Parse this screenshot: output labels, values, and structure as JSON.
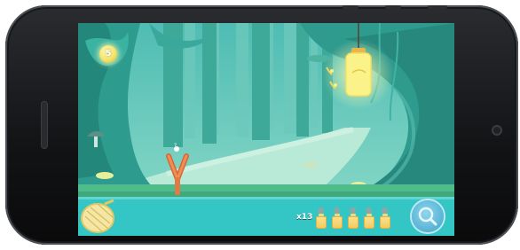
{
  "hud": {
    "coin_count": "5",
    "ammo_label": "x13",
    "jar_count": 5
  },
  "icons": {
    "coin": "coin-icon",
    "net": "butterfly-net-icon",
    "jar": "firefly-jar-icon",
    "magnifier": "magnifier-icon",
    "slingshot": "slingshot-icon"
  },
  "colors": {
    "sky": "#58c8bd",
    "ground": "#34c5c5",
    "jar_glow": "#fbf38a",
    "phone_body": "#121315"
  }
}
